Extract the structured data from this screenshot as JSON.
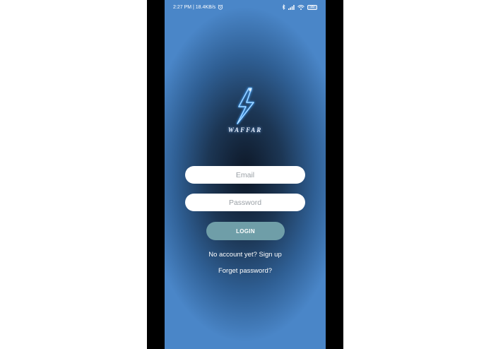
{
  "status_bar": {
    "time_speed": "2:27 PM | 18.4KB/s",
    "battery": "99",
    "icons": [
      "alarm-icon",
      "bluetooth-icon",
      "signal-icon",
      "wifi-icon",
      "battery-icon"
    ]
  },
  "logo": {
    "wordmark": "WAFFAR",
    "glow_color": "#4aa8ff"
  },
  "form": {
    "email_placeholder": "Email",
    "email_value": "",
    "password_placeholder": "Password",
    "password_value": "",
    "login_label": "LOGIN"
  },
  "links": {
    "signup": "No account yet? Sign up",
    "forgot": "Forget password?"
  },
  "colors": {
    "background_outer": "#4a86c8",
    "background_center": "#0d1726",
    "login_button": "#6f9ea8"
  }
}
